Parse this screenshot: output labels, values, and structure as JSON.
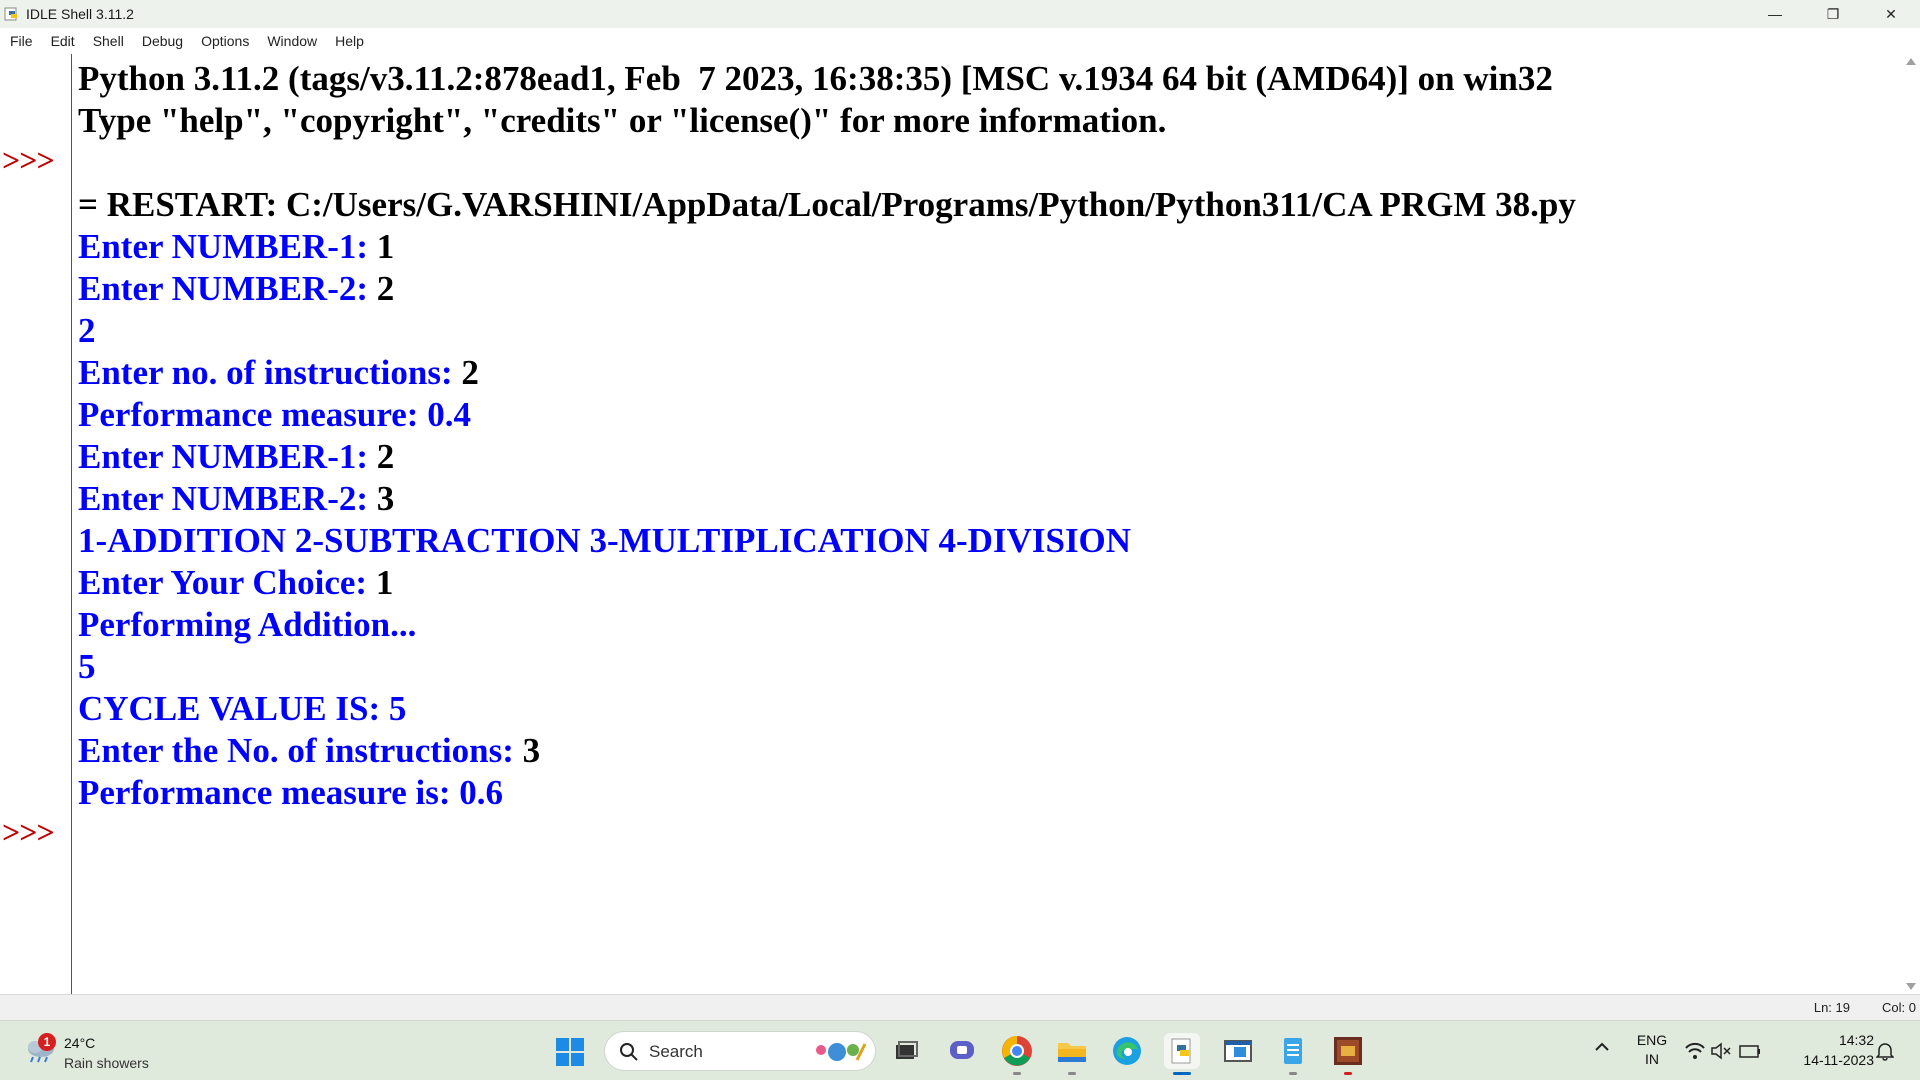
{
  "window": {
    "title": "IDLE Shell 3.11.2",
    "controls": {
      "minimize": "—",
      "restore": "❐",
      "close": "✕"
    }
  },
  "menu": [
    "File",
    "Edit",
    "Shell",
    "Debug",
    "Options",
    "Window",
    "Help"
  ],
  "shell": {
    "prompt": ">>>",
    "lines": [
      {
        "label": "Python 3.11.2 (tags/v3.11.2:878ead1, Feb  7 2023, 16:38:35) [MSC v.1934 64 bit (AMD64)] on win32",
        "value": ""
      },
      {
        "label": "Type \"help\", \"copyright\", \"credits\" or \"license()\" for more information.",
        "value": ""
      },
      {
        "label": "= RESTART: C:/Users/G.VARSHINI/AppData/Local/Programs/Python/Python311/CA PRGM 38.py",
        "value": ""
      },
      {
        "label": "Enter NUMBER-1: ",
        "value": "1"
      },
      {
        "label": "Enter NUMBER-2: ",
        "value": "2"
      },
      {
        "label": "2",
        "value": ""
      },
      {
        "label": "Enter no. of instructions: ",
        "value": "2"
      },
      {
        "label": "Performance measure: 0.4",
        "value": ""
      },
      {
        "label": "Enter NUMBER-1: ",
        "value": "2"
      },
      {
        "label": "Enter NUMBER-2: ",
        "value": "3"
      },
      {
        "label": "1-ADDITION 2-SUBTRACTION 3-MULTIPLICATION 4-DIVISION",
        "value": ""
      },
      {
        "label": "Enter Your Choice: ",
        "value": "1"
      },
      {
        "label": "Performing Addition...",
        "value": ""
      },
      {
        "label": "5",
        "value": ""
      },
      {
        "label": "CYCLE VALUE IS: 5",
        "value": ""
      },
      {
        "label": "Enter the No. of instructions: ",
        "value": "3"
      },
      {
        "label": "Performance measure is: 0.6",
        "value": ""
      }
    ]
  },
  "status": {
    "line": "Ln: 19",
    "col": "Col: 0"
  },
  "taskbar": {
    "weather": {
      "badge": "1",
      "temp": "24°C",
      "desc": "Rain showers",
      "icon": "rain-cloud-icon"
    },
    "search_label": "Search",
    "apps": [
      "start-icon",
      "task-view-icon",
      "teams-chat-icon",
      "chrome-icon",
      "file-explorer-icon",
      "edge-icon",
      "python-idle-icon",
      "window-app-icon",
      "notepad-icon",
      "dosbox-icon"
    ],
    "lang_top": "ENG",
    "lang_bottom": "IN",
    "time": "14:32",
    "date": "14-11-2023"
  },
  "colors": {
    "output_blue": "#0000ff",
    "prompt_red": "#c00000",
    "text_black": "#000000"
  }
}
